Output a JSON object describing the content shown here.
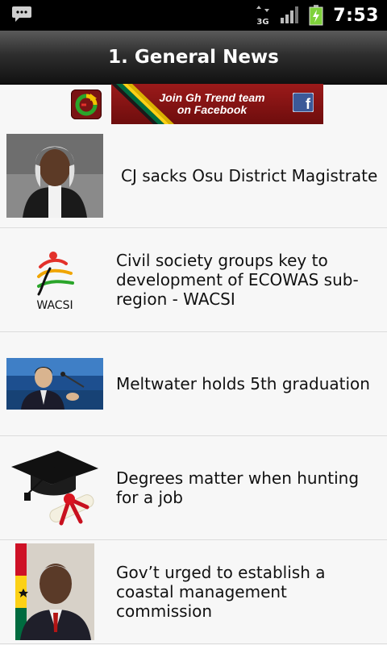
{
  "status_bar": {
    "network_label": "3G",
    "time": "7:53"
  },
  "header": {
    "title": "1. General News"
  },
  "banner": {
    "text_line1": "Join Gh Trend team",
    "text_line2": "on Facebook",
    "fb_glyph": "f"
  },
  "news": [
    {
      "title": "CJ sacks Osu District Magistrate",
      "thumb": "judge-portrait"
    },
    {
      "title": "Civil society groups key to development of ECOWAS sub-region - WACSI",
      "thumb": "wacsi-logo",
      "logo_text": "WACSI"
    },
    {
      "title": "Meltwater holds 5th graduation",
      "thumb": "speaker-photo"
    },
    {
      "title": "Degrees matter when hunting for a job",
      "thumb": "graduation-cap"
    },
    {
      "title": "Gov’t urged to establish a coastal management commission",
      "thumb": "president-portrait"
    }
  ],
  "colors": {
    "status_bar": "#000000",
    "title_bar": "#2e2e2e",
    "banner_red": "#8b1515",
    "battery_green": "#7fd13b",
    "ghana_red": "#ce1126",
    "ghana_gold": "#fcd116",
    "ghana_green": "#006b3f"
  }
}
